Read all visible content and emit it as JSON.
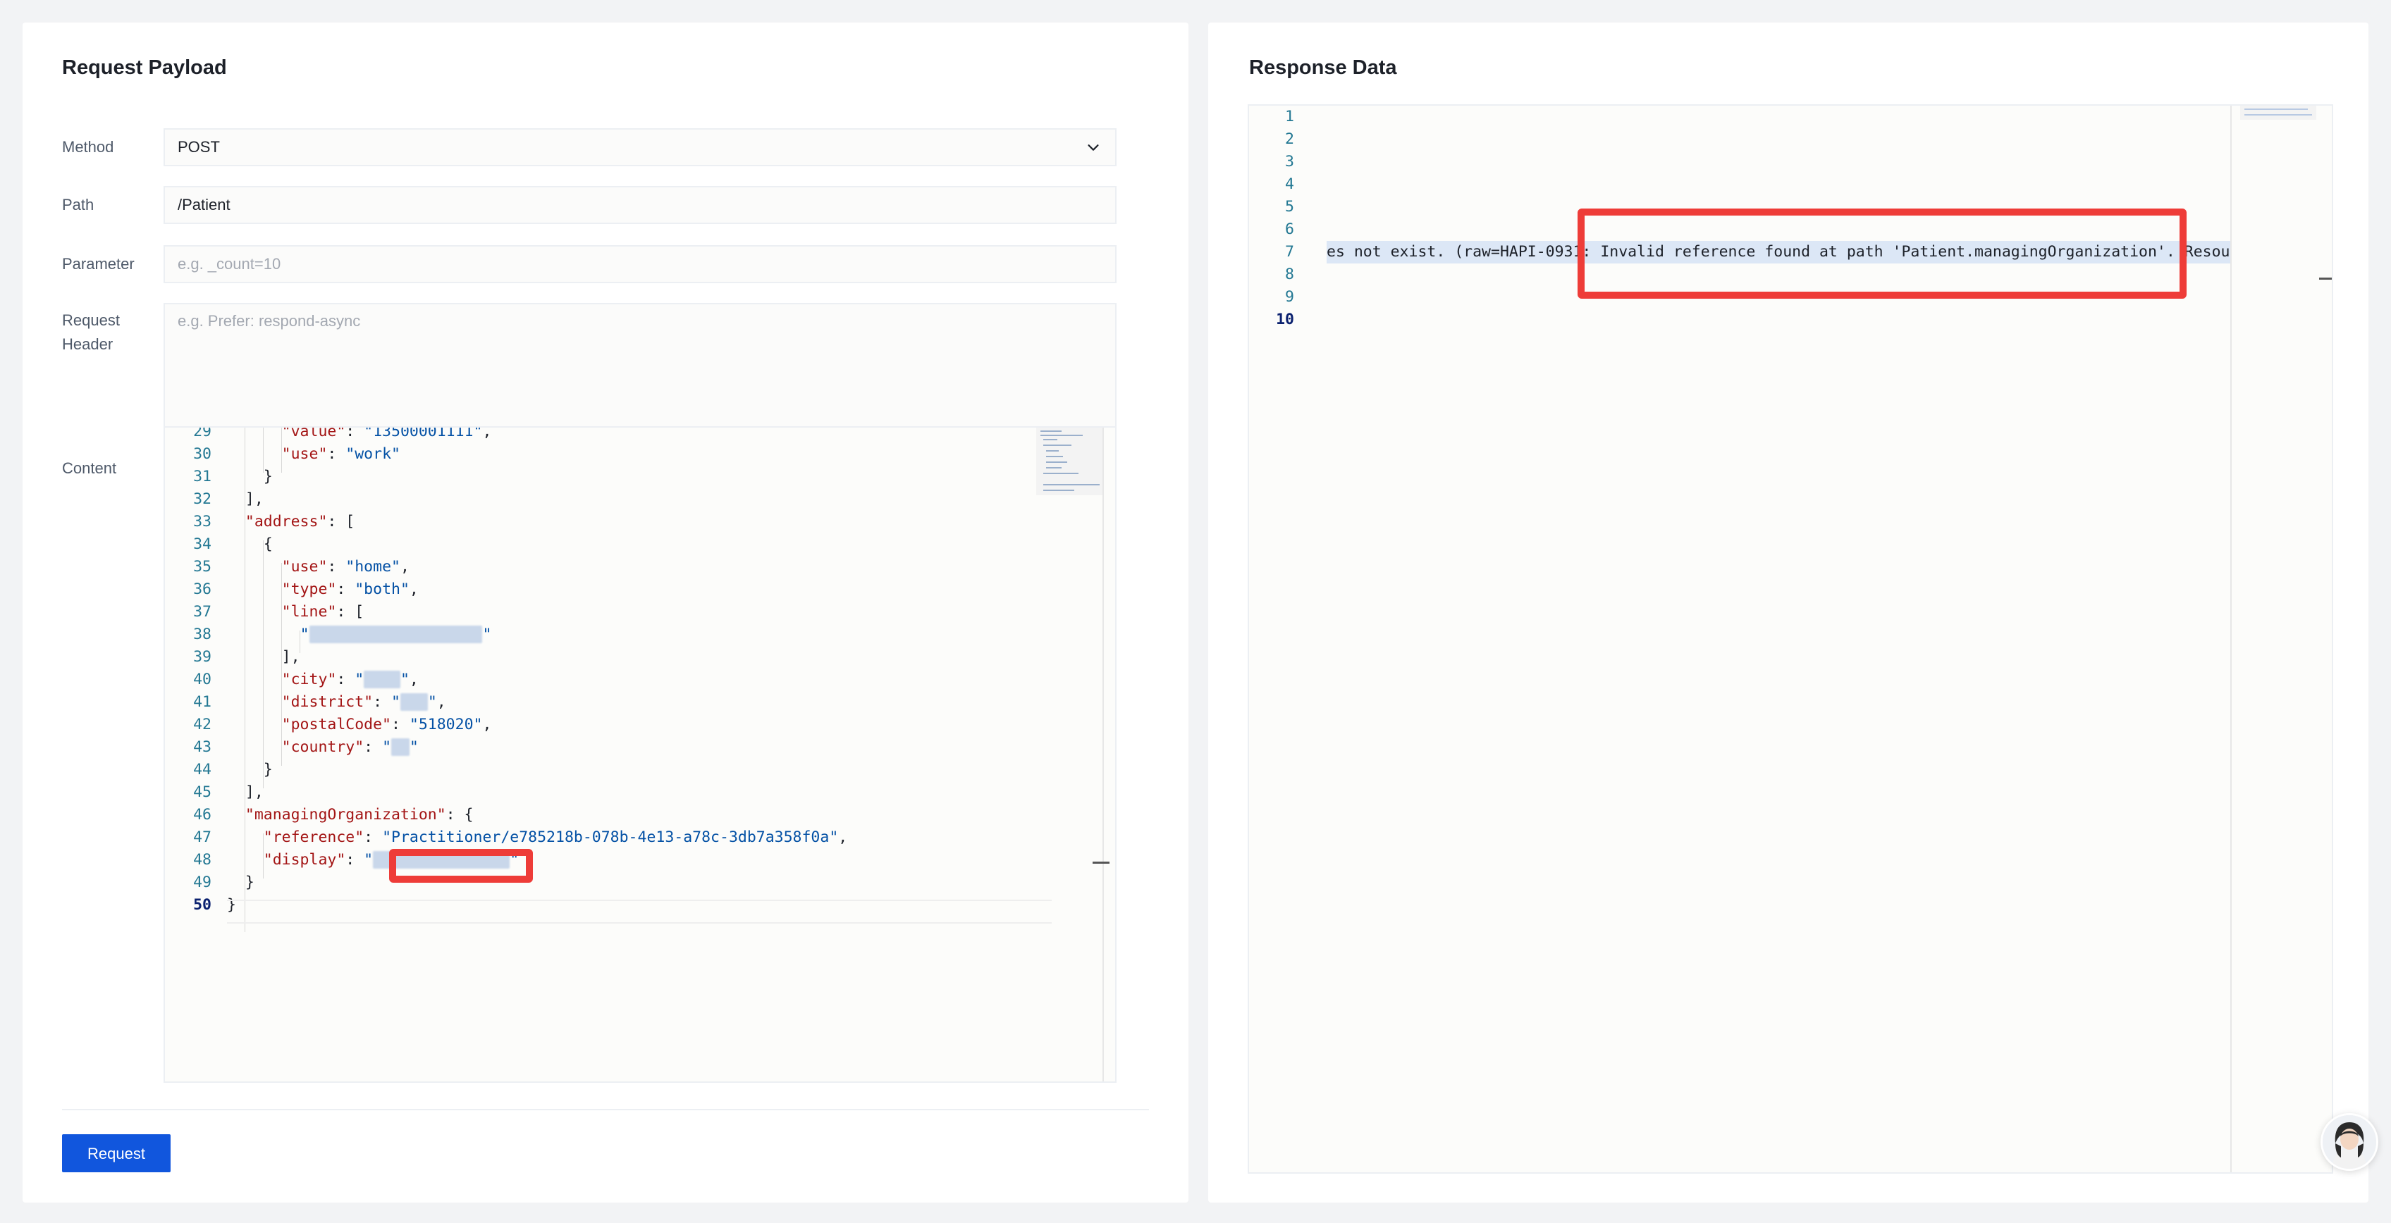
{
  "request_panel": {
    "title": "Request Payload",
    "method_label": "Method",
    "method_value": "POST",
    "path_label": "Path",
    "path_value": "/Patient",
    "parameter_label": "Parameter",
    "parameter_placeholder": "e.g. _count=10",
    "header_label_1": "Request",
    "header_label_2": "Header",
    "header_placeholder": "e.g. Prefer: respond-async",
    "content_label": "Content",
    "request_button_label": "Request"
  },
  "content_editor": {
    "lines": [
      {
        "no": "29",
        "parts": [
          [
            "p",
            "      "
          ],
          [
            "k",
            "\"value\""
          ],
          [
            "p",
            ": "
          ],
          [
            "s",
            "\"13500001111\""
          ],
          [
            "p",
            ","
          ]
        ]
      },
      {
        "no": "30",
        "parts": [
          [
            "p",
            "      "
          ],
          [
            "k",
            "\"use\""
          ],
          [
            "p",
            ": "
          ],
          [
            "s",
            "\"work\""
          ]
        ]
      },
      {
        "no": "31",
        "parts": [
          [
            "p",
            "    }"
          ]
        ]
      },
      {
        "no": "32",
        "parts": [
          [
            "p",
            "  ],"
          ]
        ]
      },
      {
        "no": "33",
        "parts": [
          [
            "p",
            "  "
          ],
          [
            "k",
            "\"address\""
          ],
          [
            "p",
            ": ["
          ]
        ]
      },
      {
        "no": "34",
        "parts": [
          [
            "p",
            "    {"
          ]
        ]
      },
      {
        "no": "35",
        "parts": [
          [
            "p",
            "      "
          ],
          [
            "k",
            "\"use\""
          ],
          [
            "p",
            ": "
          ],
          [
            "s",
            "\"home\""
          ],
          [
            "p",
            ","
          ]
        ]
      },
      {
        "no": "36",
        "parts": [
          [
            "p",
            "      "
          ],
          [
            "k",
            "\"type\""
          ],
          [
            "p",
            ": "
          ],
          [
            "s",
            "\"both\""
          ],
          [
            "p",
            ","
          ]
        ]
      },
      {
        "no": "37",
        "parts": [
          [
            "p",
            "      "
          ],
          [
            "k",
            "\"line\""
          ],
          [
            "p",
            ": ["
          ]
        ]
      },
      {
        "no": "38",
        "parts": [
          [
            "p",
            "        "
          ],
          [
            "s",
            "\""
          ],
          [
            "b",
            "                   "
          ],
          [
            "s",
            "\""
          ]
        ]
      },
      {
        "no": "39",
        "parts": [
          [
            "p",
            "      ],"
          ]
        ]
      },
      {
        "no": "40",
        "parts": [
          [
            "p",
            "      "
          ],
          [
            "k",
            "\"city\""
          ],
          [
            "p",
            ": "
          ],
          [
            "s",
            "\""
          ],
          [
            "b",
            "    "
          ],
          [
            "s",
            "\""
          ],
          [
            "p",
            ","
          ]
        ]
      },
      {
        "no": "41",
        "parts": [
          [
            "p",
            "      "
          ],
          [
            "k",
            "\"district\""
          ],
          [
            "p",
            ": "
          ],
          [
            "s",
            "\""
          ],
          [
            "b",
            "   "
          ],
          [
            "s",
            "\""
          ],
          [
            "p",
            ","
          ]
        ]
      },
      {
        "no": "42",
        "parts": [
          [
            "p",
            "      "
          ],
          [
            "k",
            "\"postalCode\""
          ],
          [
            "p",
            ": "
          ],
          [
            "s",
            "\"518020\""
          ],
          [
            "p",
            ","
          ]
        ]
      },
      {
        "no": "43",
        "parts": [
          [
            "p",
            "      "
          ],
          [
            "k",
            "\"country\""
          ],
          [
            "p",
            ": "
          ],
          [
            "s",
            "\""
          ],
          [
            "b",
            "  "
          ],
          [
            "s",
            "\""
          ]
        ]
      },
      {
        "no": "44",
        "parts": [
          [
            "p",
            "    }"
          ]
        ]
      },
      {
        "no": "45",
        "parts": [
          [
            "p",
            "  ],"
          ]
        ]
      },
      {
        "no": "46",
        "parts": [
          [
            "p",
            "  "
          ],
          [
            "k",
            "\"managingOrganization\""
          ],
          [
            "p",
            ": {"
          ]
        ]
      },
      {
        "no": "47",
        "parts": [
          [
            "p",
            "    "
          ],
          [
            "k",
            "\"reference\""
          ],
          [
            "p",
            ": "
          ],
          [
            "s",
            "\"Practitioner/e785218b-078b-4e13-a78c-3db7a358f0a\""
          ],
          [
            "p",
            ","
          ]
        ]
      },
      {
        "no": "48",
        "parts": [
          [
            "p",
            "    "
          ],
          [
            "k",
            "\"display\""
          ],
          [
            "p",
            ": "
          ],
          [
            "s",
            "\""
          ],
          [
            "b",
            "               "
          ],
          [
            "s",
            "\""
          ]
        ]
      },
      {
        "no": "49",
        "parts": [
          [
            "p",
            "  }"
          ]
        ]
      },
      {
        "no": "50",
        "parts": [
          [
            "p",
            "}"
          ]
        ]
      }
    ]
  },
  "response_panel": {
    "title": "Response Data",
    "line_numbers": [
      "1",
      "2",
      "3",
      "4",
      "5",
      "6",
      "7",
      "8",
      "9",
      "10"
    ],
    "line7_text": "es not exist. (raw=HAPI-0931: Invalid reference found at path 'Patient.managingOrganization'. Resour"
  },
  "colors": {
    "accent": "#1156dd",
    "highlight": "#ee3c38",
    "json_key": "#a31515",
    "json_string": "#0451a5",
    "line_number": "#237893"
  },
  "icons": {
    "method_select": "chevron-down-icon",
    "assistant": "avatar"
  }
}
